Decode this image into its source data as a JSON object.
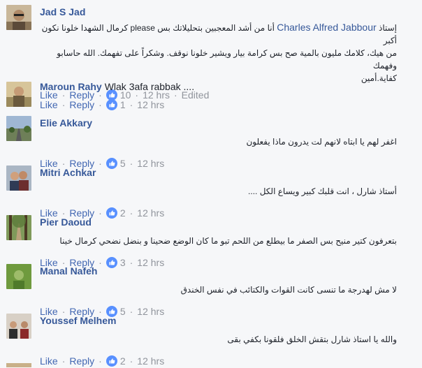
{
  "comments": [
    {
      "author": "Jad S Jad",
      "text": "",
      "rtl_lines": [
        "إستاذ {mention} أنا من أشد المعجبين بتحليلاتك بس please كرمال الشهدا خلونا نكون أكبر",
        "من هيك، كلامك مليون بالمية صح بس كرامة بيار ويشير خلونا نوقف. وشكراً على تفهمك. الله حاسابو وفهمك",
        "كفاية.أمين"
      ],
      "mention": "Charles Alfred Jabbour",
      "actions": {
        "like": "Like",
        "reply": "Reply"
      },
      "reactions": "10",
      "time": "12 hrs",
      "edited": "Edited",
      "avatar": "man-with-sunglasses"
    },
    {
      "author": "Maroun Rahy",
      "text": "Wlak 3afa rabbak ....",
      "rtl_lines": [],
      "actions": {
        "like": "Like",
        "reply": "Reply"
      },
      "reactions": "1",
      "time": "12 hrs",
      "avatar": "man-outdoors"
    },
    {
      "author": "Elie Akkary",
      "text": "",
      "rtl_lines": [
        "اغفر لهم يا ابتاه لانهم لت يدرون ماذا يفعلون"
      ],
      "actions": {
        "like": "Like",
        "reply": "Reply"
      },
      "reactions": "5",
      "time": "12 hrs",
      "avatar": "road-landscape"
    },
    {
      "author": "Mitri Achkar",
      "text": "",
      "rtl_lines": [
        "أستاذ شارل ، انت قلبك كبير ويساع الكل ...."
      ],
      "actions": {
        "like": "Like",
        "reply": "Reply"
      },
      "reactions": "2",
      "time": "12 hrs",
      "avatar": "couple-photo"
    },
    {
      "author": "Pier Daoud",
      "text": "",
      "rtl_lines": [
        "بتعرفون كتير منيح بس الصفر ما بيطلع من اللحم تبو ما كان الوضع ضحينا و بنضل نضحي كرمال خينا"
      ],
      "actions": {
        "like": "Like",
        "reply": "Reply"
      },
      "reactions": "3",
      "time": "12 hrs",
      "avatar": "forest-path"
    },
    {
      "author": "Manal Nafeh",
      "text": "",
      "rtl_lines": [
        "لا مش لهدرجة ما تنسى كانت القوات والكتائب في نفس الخندق"
      ],
      "actions": {
        "like": "Like",
        "reply": "Reply"
      },
      "reactions": "5",
      "time": "12 hrs",
      "avatar": "green-portrait"
    },
    {
      "author": "Youssef Melhem",
      "text": "",
      "rtl_lines": [
        "والله يا استاذ شارل بتقش الخلق فلقونا بكفي بقى"
      ],
      "actions": {
        "like": "Like",
        "reply": "Reply"
      },
      "reactions": "2",
      "time": "12 hrs",
      "avatar": "group-photo"
    }
  ],
  "colors": {
    "name": "#365899",
    "link": "#4267b2",
    "muted": "#90949c",
    "background": "#f6f7f9",
    "like_badge": "#5890ff"
  }
}
